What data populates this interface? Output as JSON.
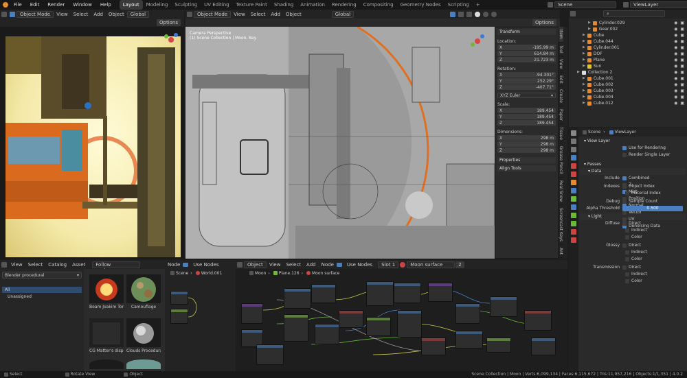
{
  "menu": [
    "File",
    "Edit",
    "Render",
    "Window",
    "Help"
  ],
  "workspaces": [
    "Layout",
    "Modeling",
    "Sculpting",
    "UV Editing",
    "Texture Paint",
    "Shading",
    "Animation",
    "Rendering",
    "Compositing",
    "Geometry Nodes",
    "Scripting"
  ],
  "active_workspace": "Layout",
  "scene_name": "Scene",
  "view_layer_name": "ViewLayer",
  "viewport_left": {
    "mode": "Object Mode",
    "menus": [
      "View",
      "Select",
      "Add",
      "Object"
    ],
    "orientation": "Global",
    "options": "Options"
  },
  "viewport_main": {
    "mode": "Object Mode",
    "menus": [
      "View",
      "Select",
      "Add",
      "Object"
    ],
    "orientation": "Global",
    "options": "Options",
    "overlay_line1": "Camera Perspective",
    "overlay_line2": "(1) Scene Collection | Moon, Key"
  },
  "n_panel": {
    "transform_title": "Transform",
    "location_label": "Location:",
    "location": [
      {
        "axis": "X",
        "value": "-195.99 m"
      },
      {
        "axis": "Y",
        "value": "614.84 m"
      },
      {
        "axis": "Z",
        "value": "21.723 m"
      }
    ],
    "rotation_label": "Rotation:",
    "rotation": [
      {
        "axis": "X",
        "value": "-94.301°"
      },
      {
        "axis": "Y",
        "value": "252.29°"
      },
      {
        "axis": "Z",
        "value": "-407.71°"
      }
    ],
    "rotation_mode": "XYZ Euler",
    "scale_label": "Scale:",
    "scale": [
      {
        "axis": "X",
        "value": "189.454"
      },
      {
        "axis": "Y",
        "value": "189.454"
      },
      {
        "axis": "Z",
        "value": "189.454"
      }
    ],
    "dimensions_label": "Dimensions:",
    "dimensions": [
      {
        "axis": "X",
        "value": "298 m"
      },
      {
        "axis": "Y",
        "value": "298 m"
      },
      {
        "axis": "Z",
        "value": "298 m"
      }
    ],
    "properties": "Properties",
    "align_tools": "Align Tools"
  },
  "side_tabs": [
    "Item",
    "Tool",
    "View",
    "Edit",
    "Create",
    "Paper",
    "Tissue",
    "Grease Pencil",
    "Real Snow",
    "Screencast Keys",
    "Ant"
  ],
  "outliner": {
    "items": [
      {
        "name": "Cylinder.029",
        "indent": 3,
        "color": "#e38b2e"
      },
      {
        "name": "Gear.002",
        "indent": 3,
        "color": "#e38b2e"
      },
      {
        "name": "Cube",
        "indent": 2,
        "color": "#e38b2e"
      },
      {
        "name": "Cube.044",
        "indent": 2,
        "color": "#e38b2e"
      },
      {
        "name": "Cylinder.001",
        "indent": 2,
        "color": "#e38b2e"
      },
      {
        "name": "DOF",
        "indent": 2,
        "color": "#e38b2e"
      },
      {
        "name": "Plane",
        "indent": 2,
        "color": "#e38b2e"
      },
      {
        "name": "Sun",
        "indent": 2,
        "color": "#e3c52e"
      },
      {
        "name": "Collection 2",
        "indent": 1,
        "color": "#dddddd"
      },
      {
        "name": "Cube.001",
        "indent": 2,
        "color": "#e38b2e"
      },
      {
        "name": "Cube.002",
        "indent": 2,
        "color": "#e38b2e"
      },
      {
        "name": "Cube.003",
        "indent": 2,
        "color": "#e38b2e"
      },
      {
        "name": "Cube.004",
        "indent": 2,
        "color": "#e38b2e"
      },
      {
        "name": "Cube.012",
        "indent": 2,
        "color": "#e38b2e"
      }
    ]
  },
  "properties": {
    "breadcrumb_scene": "Scene",
    "breadcrumb_layer": "ViewLayer",
    "view_layer_section": "View Layer",
    "use_for_rendering": "Use for Rendering",
    "render_single_layer": "Render Single Layer",
    "passes_section": "Passes",
    "data_section": "Data",
    "include_label": "Include",
    "include_items": [
      {
        "label": "Combined",
        "on": true
      },
      {
        "label": "Z",
        "on": false
      },
      {
        "label": "Mist",
        "on": true
      },
      {
        "label": "Position",
        "on": false
      },
      {
        "label": "Normal",
        "on": true
      },
      {
        "label": "Vector",
        "on": false
      },
      {
        "label": "UV",
        "on": false
      },
      {
        "label": "Denoising Data",
        "on": true
      }
    ],
    "indexes_label": "Indexes",
    "indexes_items": [
      "Object Index",
      "Material Index"
    ],
    "debug_label": "Debug",
    "debug_item": "Sample Count",
    "alpha_label": "Alpha Threshold",
    "alpha_value": "0.500",
    "light_section": "Light",
    "diffuse_label": "Diffuse",
    "glossy_label": "Glossy",
    "transmission_label": "Transmission",
    "light_items": [
      "Direct",
      "Indirect",
      "Color"
    ]
  },
  "asset_browser": {
    "menus": [
      "View",
      "Select",
      "Catalog",
      "Asset"
    ],
    "preferences": "Follow Preferences",
    "library": "Blender procedural",
    "catalogs": [
      "All",
      "Unassigned"
    ],
    "assets": [
      "Beam Joakim Tor...",
      "Camouflage",
      "CG Matter's disp...",
      "Clouds Procedura..."
    ]
  },
  "node_editor_left": {
    "label": "Node",
    "use_nodes": "Use Nodes",
    "breadcrumb": [
      "Scene",
      "World.001"
    ]
  },
  "node_editor_main": {
    "object": "Object",
    "menus": [
      "View",
      "Select",
      "Add",
      "Node"
    ],
    "use_nodes": "Use Nodes",
    "slot": "Slot 1",
    "material": "Moon surface",
    "users": "2",
    "breadcrumb": [
      "Moon",
      "Plane.126",
      "Moon surface"
    ]
  },
  "status": {
    "select": "Select",
    "rotate": "Rotate View",
    "object": "Object",
    "stats": "Scene Collection | Moon | Verts:6,099,134 | Faces:6,115,672 | Tris:11,957,216 | Objects:1/1,351 | 4.0.2"
  },
  "colors": {
    "accent": "#4a7fc1",
    "orange": "#e38b2e",
    "alpha_bar": "#4a7fc1"
  }
}
